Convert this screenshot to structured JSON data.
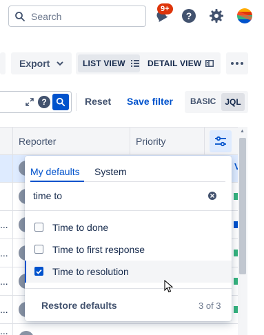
{
  "topbar": {
    "search_placeholder": "Search",
    "notifications_badge": "9+",
    "icons": [
      "search-icon",
      "notifications-icon",
      "help-icon",
      "settings-icon",
      "profile-avatar"
    ]
  },
  "toolbar": {
    "export_label": "Export",
    "list_view_label": "LIST VIEW",
    "detail_view_label": "DETAIL VIEW",
    "more_icon": "more-icon"
  },
  "query": {
    "reset_label": "Reset",
    "save_filter_label": "Save filter",
    "basic_label": "BASIC",
    "jql_label": "JQL",
    "help_glyph": "?"
  },
  "table": {
    "columns": [
      "Reporter",
      "Priority"
    ],
    "last_row_fragment": "..."
  },
  "column_picker": {
    "tabs": [
      "My defaults",
      "System"
    ],
    "active_tab": "My defaults",
    "filter_value": "time to",
    "options": [
      {
        "label": "Time to done",
        "checked": false
      },
      {
        "label": "Time to first response",
        "checked": false
      },
      {
        "label": "Time to resolution",
        "checked": true
      }
    ],
    "restore_label": "Restore defaults",
    "count_label": "3 of 3"
  },
  "colors": {
    "accent": "#0052cc",
    "badge": "#de350b",
    "selected_row": "#deebff"
  }
}
